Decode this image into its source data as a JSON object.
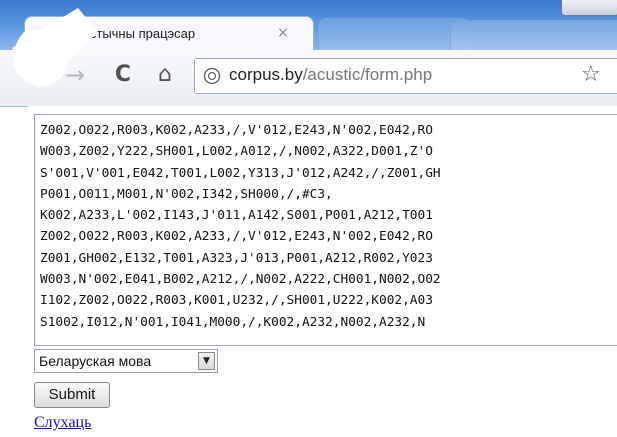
{
  "browser": {
    "tab_title": "Акустычны працэсар",
    "tab_close": "×",
    "url_domain": "corpus.by",
    "url_path": "/acustic/form.php",
    "star": "☆",
    "back": "←",
    "forward": "→",
    "reload": "C",
    "home": "⌂"
  },
  "form": {
    "text_lines": [
      "Z002,O022,R003,K002,A233,/,V'012,E243,N'002,E042,RO",
      "W003,Z002,Y222,SH001,L002,A012,/,N002,A322,D001,Z'O",
      "S'001,V'001,E042,T001,L002,Y313,J'012,A242,/,Z001,GH",
      "P001,O011,M001,N'002,I342,SH000,/,#C3,",
      "K002,A233,L'002,I143,J'011,A142,S001,P001,A212,T001 ",
      "Z002,O022,R003,K002,A233,/,V'012,E243,N'002,E042,RO",
      "Z001,GH002,E132,T001,A323,J'013,P001,A212,R002,Y023",
      "W003,N'002,E041,B002,A212,/,N002,A222,CH001,N002,O02",
      "I102,Z002,O022,R003,K001,U232,/,SH001,U222,K002,A03",
      "S1002,I012,N'001,I041,M000,/,K002,A232,N002,A232,N"
    ],
    "language_selected": "Беларуская мова",
    "dropdown_arrow": "▼",
    "submit_label": "Submit",
    "listen_link": "Слухаць"
  },
  "colors": {
    "tab_strip": "#3a78cf",
    "link": "#1a0dab",
    "watermark": "#e03030"
  },
  "icons": [
    "page-favicon-icon",
    "back-arrow-icon",
    "forward-arrow-icon",
    "reload-icon",
    "home-icon",
    "page-icon",
    "bookmark-star-icon",
    "dropdown-arrow-icon"
  ]
}
